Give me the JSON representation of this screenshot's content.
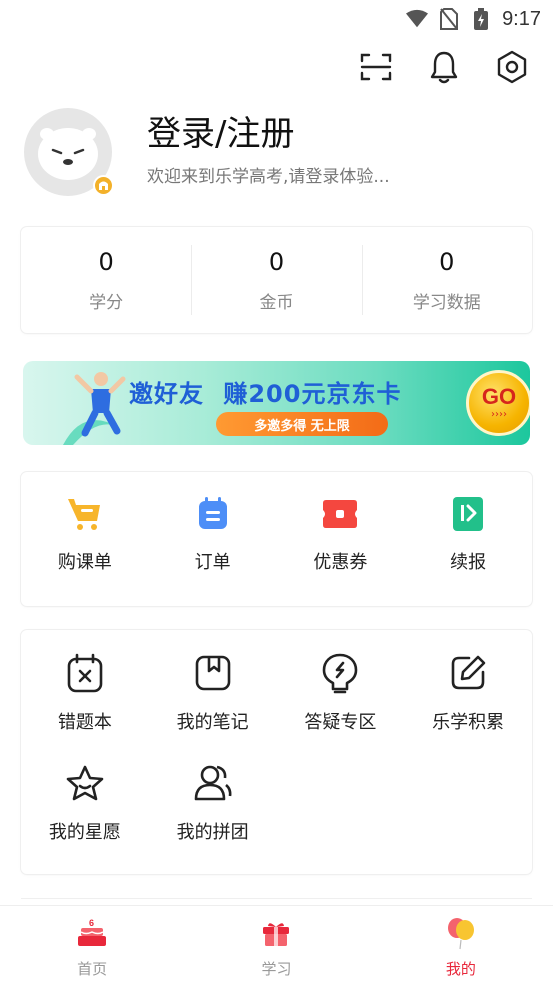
{
  "status_bar": {
    "time": "9:17",
    "icons": [
      "wifi-icon",
      "no-sim-icon",
      "battery-charging-icon"
    ]
  },
  "top_actions": {
    "icons": [
      "scan-icon",
      "bell-icon",
      "settings-icon"
    ]
  },
  "profile": {
    "title": "登录/注册",
    "subtitle": "欢迎来到乐学高考,请登录体验..."
  },
  "stats": [
    {
      "value": "0",
      "label": "学分"
    },
    {
      "value": "0",
      "label": "金币"
    },
    {
      "value": "0",
      "label": "学习数据"
    }
  ],
  "banner": {
    "title_prefix": "邀好友",
    "title_earn": "赚",
    "title_amount": "200元",
    "title_suffix": "京东卡",
    "pill": "多邀多得 无上限",
    "go": "GO",
    "go_arrows": "››››"
  },
  "shortcuts": [
    {
      "label": "购课单",
      "icon": "cart-icon",
      "color": "#f7b52b"
    },
    {
      "label": "订单",
      "icon": "order-icon",
      "color": "#4d8ef7"
    },
    {
      "label": "优惠券",
      "icon": "coupon-icon",
      "color": "#f4473f"
    },
    {
      "label": "续报",
      "icon": "renew-icon",
      "color": "#22c08a"
    }
  ],
  "tools": [
    {
      "label": "错题本",
      "icon": "wrong-questions-icon"
    },
    {
      "label": "我的笔记",
      "icon": "notebook-icon"
    },
    {
      "label": "答疑专区",
      "icon": "qa-bulb-icon"
    },
    {
      "label": "乐学积累",
      "icon": "edit-icon"
    },
    {
      "label": "我的星愿",
      "icon": "star-icon"
    },
    {
      "label": "我的拼团",
      "icon": "group-users-icon"
    }
  ],
  "tabbar": [
    {
      "label": "首页",
      "icon": "cake-icon",
      "active": false
    },
    {
      "label": "学习",
      "icon": "gift-icon",
      "active": false
    },
    {
      "label": "我的",
      "icon": "balloon-icon",
      "active": true
    }
  ],
  "colors": {
    "accent_red": "#e8283b",
    "banner_blue": "#1f5fd6",
    "banner_green": "#1cc79d"
  }
}
